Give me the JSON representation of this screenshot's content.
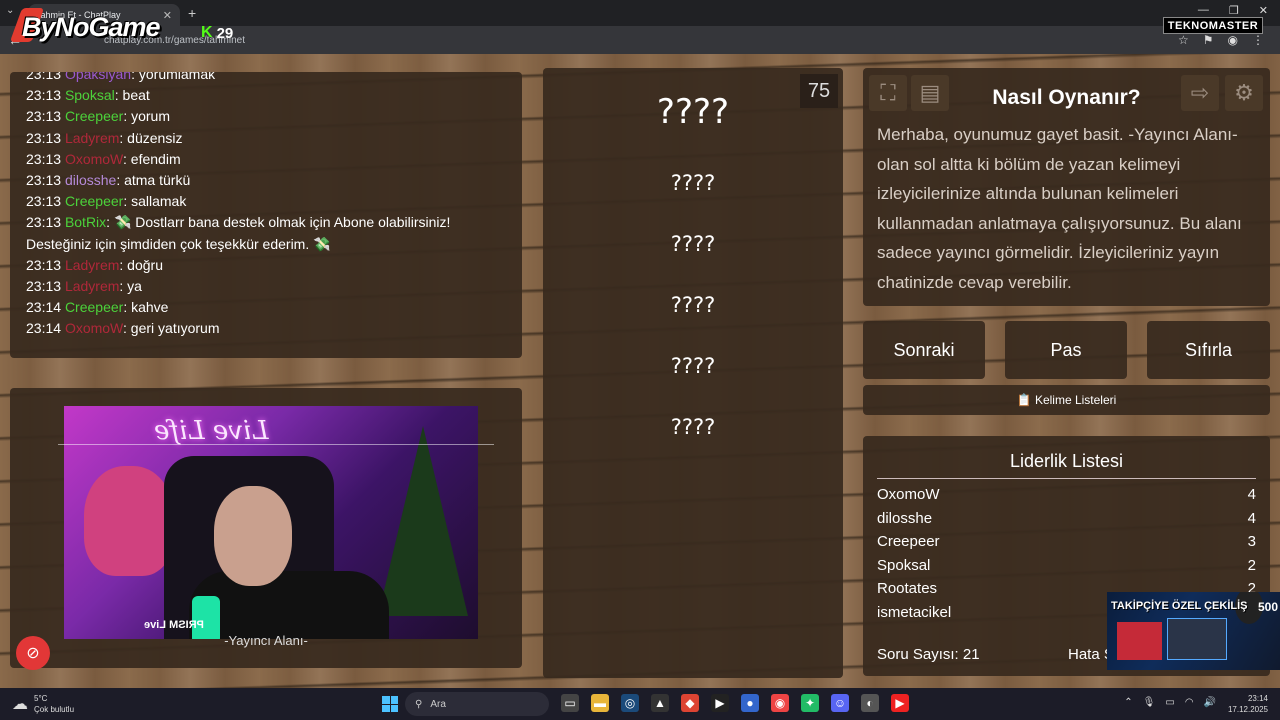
{
  "browser": {
    "tab_title": "Tahmin Et - ChatPlay",
    "tab_close": "✕",
    "new_tab": "+",
    "url": "chatplay.com.tr/games/tahminet",
    "window_controls": [
      "—",
      "❐",
      "✕"
    ]
  },
  "overlay": {
    "logo_text": "ByNoGame",
    "kick_count": "29",
    "kick_k": "K",
    "sponsor": "TEKNOMASTER"
  },
  "chat": {
    "messages": [
      {
        "time": "23:13",
        "user": "Opaksiyah",
        "user_color": "#9b59d0",
        "text": ": yorumlamak"
      },
      {
        "time": "23:13",
        "user": "Spoksal",
        "user_color": "#4cd23b",
        "text": ": beat"
      },
      {
        "time": "23:13",
        "user": "Creepeer",
        "user_color": "#4cd23b",
        "text": ": yorum"
      },
      {
        "time": "23:13",
        "user": "Ladyrem",
        "user_color": "#b0283a",
        "text": ": düzensiz"
      },
      {
        "time": "23:13",
        "user": "OxomoW",
        "user_color": "#b0283a",
        "text": ": efendim"
      },
      {
        "time": "23:13",
        "user": "dilosshe",
        "user_color": "#b58ad8",
        "text": ": atma türkü"
      },
      {
        "time": "23:13",
        "user": "Creepeer",
        "user_color": "#4cd23b",
        "text": ": sallamak"
      },
      {
        "time": "23:13",
        "user": "BotRix",
        "user_color": "#4cd23b",
        "text": ": 💸 Dostlarr bana destek olmak için Abone olabilirsiniz!"
      },
      {
        "time": "",
        "user": "",
        "user_color": "#ffffff",
        "text": "Desteğiniz için şimdiden çok teşekkür ederim. 💸"
      },
      {
        "time": "23:13",
        "user": "Ladyrem",
        "user_color": "#b0283a",
        "text": ": doğru"
      },
      {
        "time": "23:13",
        "user": "Ladyrem",
        "user_color": "#b0283a",
        "text": ": ya"
      },
      {
        "time": "23:14",
        "user": "Creepeer",
        "user_color": "#4cd23b",
        "text": ": kahve"
      },
      {
        "time": "23:14",
        "user": "OxomoW",
        "user_color": "#b0283a",
        "text": ": geri yatıyorum"
      }
    ]
  },
  "stream": {
    "label": "-Yayıncı Alanı-",
    "neon_text": "Live Life",
    "prism": "PRISM Live"
  },
  "words": {
    "timer": "75",
    "main": "????",
    "list": [
      "????",
      "????",
      "????",
      "????",
      "????"
    ]
  },
  "how": {
    "title": "Nasıl Oynanır?",
    "text": "Merhaba, oyunumuz gayet basit. -Yayıncı Alanı- olan sol altta ki bölüm de yazan kelimeyi izleyicilerinize altında bulunan kelimeleri kullanmadan anlatmaya çalışıyorsunuz. Bu alanı sadece yayıncı görmelidir. İzleyicileriniz yayın chatinizde cevap verebilir."
  },
  "buttons": {
    "next": "Sonraki",
    "pass": "Pas",
    "reset": "Sıfırla",
    "word_lists": "📋 Kelime Listeleri"
  },
  "leaderboard": {
    "title": "Liderlik Listesi",
    "rows": [
      {
        "name": "OxomoW",
        "score": "4"
      },
      {
        "name": "dilosshe",
        "score": "4"
      },
      {
        "name": "Creepeer",
        "score": "3"
      },
      {
        "name": "Spoksal",
        "score": "2"
      },
      {
        "name": "Rootates",
        "score": "2"
      },
      {
        "name": "ismetacikel",
        "score": ""
      }
    ],
    "question_count": "Soru Sayısı: 21",
    "error_count": "Hata Sayısı"
  },
  "promo": {
    "text": "TAKİPÇİYE ÖZEL ÇEKİLİŞ",
    "number": "500"
  },
  "taskbar": {
    "temp": "5°C",
    "weather": "Çok bulutlu",
    "search_placeholder": "Ara",
    "time": "23:14",
    "date": "17.12.2025"
  }
}
